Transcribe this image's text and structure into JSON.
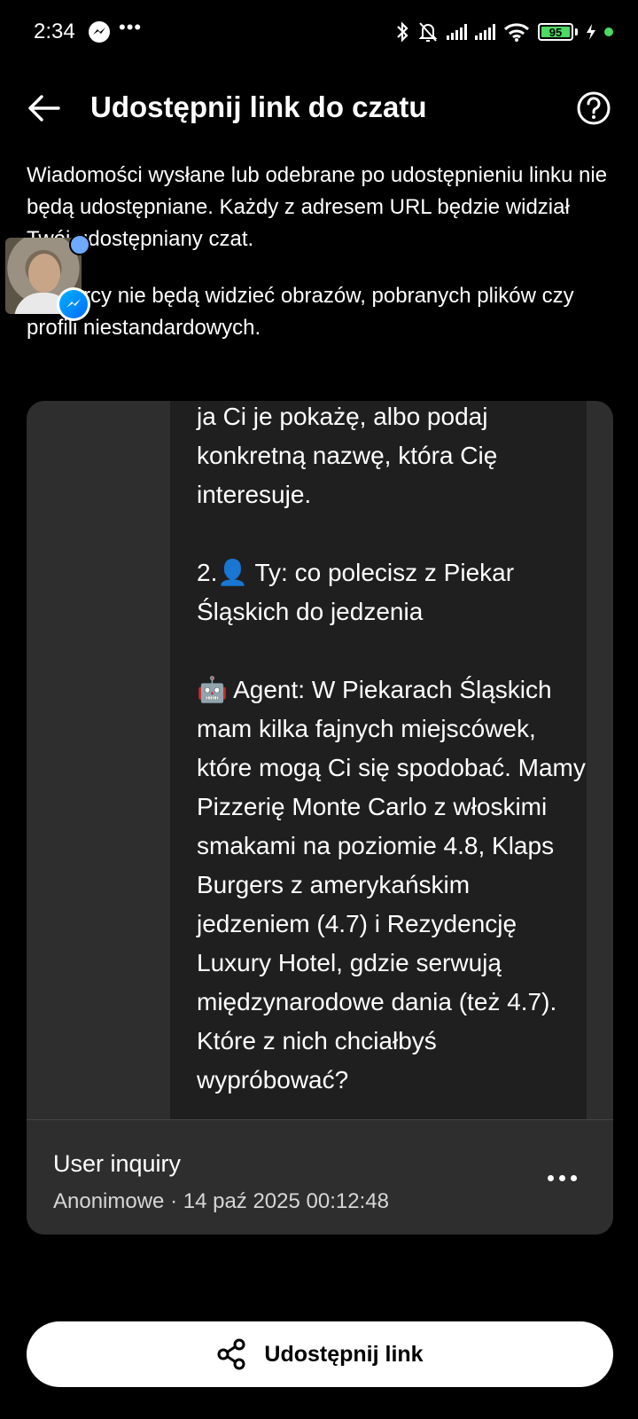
{
  "status_bar": {
    "time": "2:34",
    "more": "•••",
    "battery": "95",
    "battery_color": "#4cd964"
  },
  "header": {
    "title": "Udostępnij link do czatu",
    "back_icon": "arrow-left-icon",
    "help_icon": "question-circle-icon"
  },
  "description": {
    "paragraph1": "Wiadomości wysłane lub odebrane po udostępnieniu linku nie będą udostępniane. Każdy z adresem URL będzie widział Twój udostępniany czat.",
    "paragraph2": "Odbiorcy nie będą widzieć obrazów, pobranych plików czy profili niestandardowych."
  },
  "preview": {
    "message": "ja Ci je pokażę, albo podaj konkretną nazwę, która Cię interesuje.\n\n2.👤 Ty: co polecisz z Piekar Śląskich do jedzenia\n\n🤖 Agent: W Piekarach Śląskich mam kilka fajnych miejscówek, które mogą Ci się spodobać. Mamy Pizzerię Monte Carlo z włoskimi smakami na poziomie 4.8, Klaps Burgers z amerykańskim jedzeniem (4.7) i Rezydencję Luxury Hotel, gdzie serwują międzynarodowe dania (też 4.7). Które z nich chciałbyś wypróbować?",
    "chat_title": "User inquiry",
    "chat_meta": "Anonimowe · 14 paź 2025 00:12:48"
  },
  "share_button": {
    "label": "Udostępnij link",
    "icon": "share-icon"
  },
  "colors": {
    "background": "#000000",
    "card": "#2e2e2e",
    "bubble": "#1f1f1f",
    "messenger_blue": "#006aff"
  }
}
